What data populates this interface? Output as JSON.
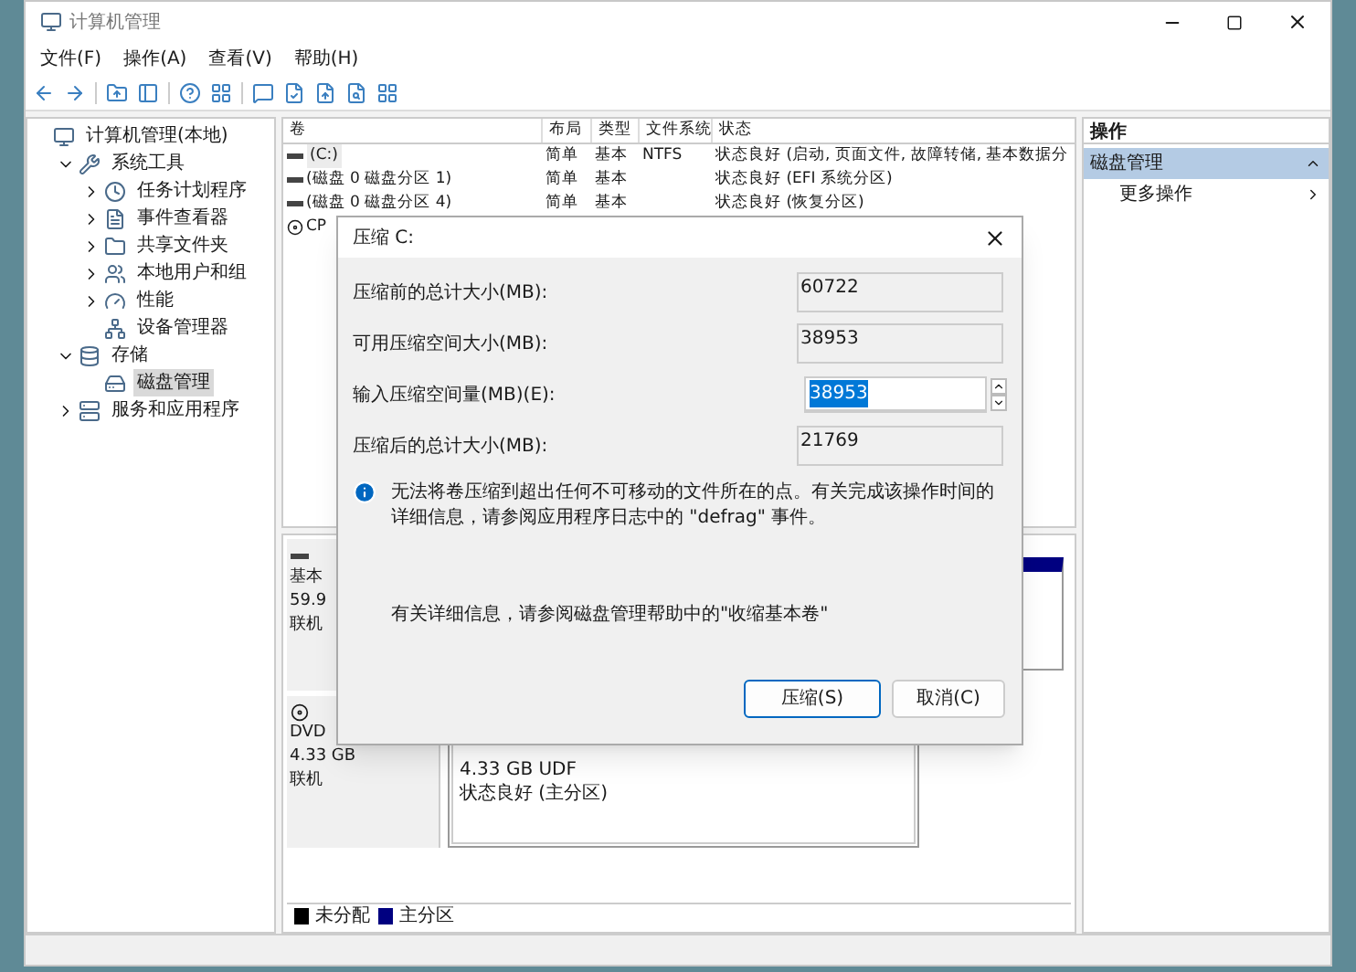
{
  "window": {
    "title": "计算机管理"
  },
  "menu": [
    "文件(F)",
    "操作(A)",
    "查看(V)",
    "帮助(H)"
  ],
  "tree": [
    {
      "label": "计算机管理(本地)",
      "kind": "computer",
      "selected": false,
      "children": [
        {
          "label": "系统工具",
          "kind": "tools",
          "expanded": true,
          "selected": false,
          "children": [
            {
              "label": "任务计划程序",
              "kind": "clock",
              "expanded": false,
              "selected": false
            },
            {
              "label": "事件查看器",
              "kind": "log",
              "expanded": false,
              "selected": false
            },
            {
              "label": "共享文件夹",
              "kind": "folder",
              "expanded": false,
              "selected": false
            },
            {
              "label": "本地用户和组",
              "kind": "users",
              "expanded": false,
              "selected": false
            },
            {
              "label": "性能",
              "kind": "gauge",
              "expanded": false,
              "selected": false
            },
            {
              "label": "设备管理器",
              "kind": "device",
              "selected": false
            }
          ]
        },
        {
          "label": "存储",
          "kind": "storage",
          "expanded": true,
          "selected": false,
          "children": [
            {
              "label": "磁盘管理",
              "kind": "disk",
              "selected": true
            }
          ]
        },
        {
          "label": "服务和应用程序",
          "kind": "services",
          "expanded": false,
          "selected": false
        }
      ]
    }
  ],
  "volumes": {
    "columns": [
      "卷",
      "布局",
      "类型",
      "文件系统",
      "状态"
    ],
    "rows": [
      {
        "kind": "partition",
        "cells": [
          "(C:)",
          "简单",
          "基本",
          "NTFS",
          "状态良好 (启动, 页面文件, 故障转储, 基本数据分"
        ],
        "selected": true
      },
      {
        "kind": "partition",
        "cells": [
          "(磁盘 0 磁盘分区 1)",
          "简单",
          "基本",
          "",
          "状态良好 (EFI 系统分区)"
        ],
        "selected": false
      },
      {
        "kind": "partition",
        "cells": [
          "(磁盘 0 磁盘分区 4)",
          "简单",
          "基本",
          "",
          "状态良好 (恢复分区)"
        ],
        "selected": false
      },
      {
        "kind": "cdrom",
        "cells": [
          "CP"
        ],
        "selected": false
      }
    ]
  },
  "disks": [
    {
      "kind": "disk",
      "lines": [
        "基本",
        "59.9",
        "联机"
      ]
    },
    {
      "kind": "cdrom",
      "lines": [
        "DVD",
        "4.33 GB",
        "联机"
      ],
      "partition": [
        "4.33 GB UDF",
        "状态良好 (主分区)"
      ]
    }
  ],
  "legend": [
    {
      "label": "未分配",
      "color": "#000000"
    },
    {
      "label": "主分区",
      "color": "#000080"
    }
  ],
  "actions": {
    "title": "操作",
    "items": [
      {
        "kind": "section",
        "label": "磁盘管理"
      },
      {
        "kind": "item",
        "label": "更多操作"
      }
    ]
  },
  "dialog": {
    "title": "压缩 C:",
    "fields": [
      {
        "kind": "readonly",
        "label": "压缩前的总计大小(MB):",
        "value": "60722"
      },
      {
        "kind": "readonly",
        "label": "可用压缩空间大小(MB):",
        "value": "38953"
      },
      {
        "kind": "spin",
        "label": "输入压缩空间量(MB)(E):",
        "value": "38953",
        "highlighted": true
      },
      {
        "kind": "readonly",
        "label": "压缩后的总计大小(MB):",
        "value": "21769"
      }
    ],
    "note": "无法将卷压缩到超出任何不可移动的文件所在的点。有关完成该操作时间的详细信息，请参阅应用程序日志中的 \"defrag\" 事件。",
    "help": "有关详细信息，请参阅磁盘管理帮助中的\"收缩基本卷\"",
    "buttons": [
      {
        "label": "压缩(S)",
        "default": true
      },
      {
        "label": "取消(C)",
        "default": false
      }
    ]
  }
}
